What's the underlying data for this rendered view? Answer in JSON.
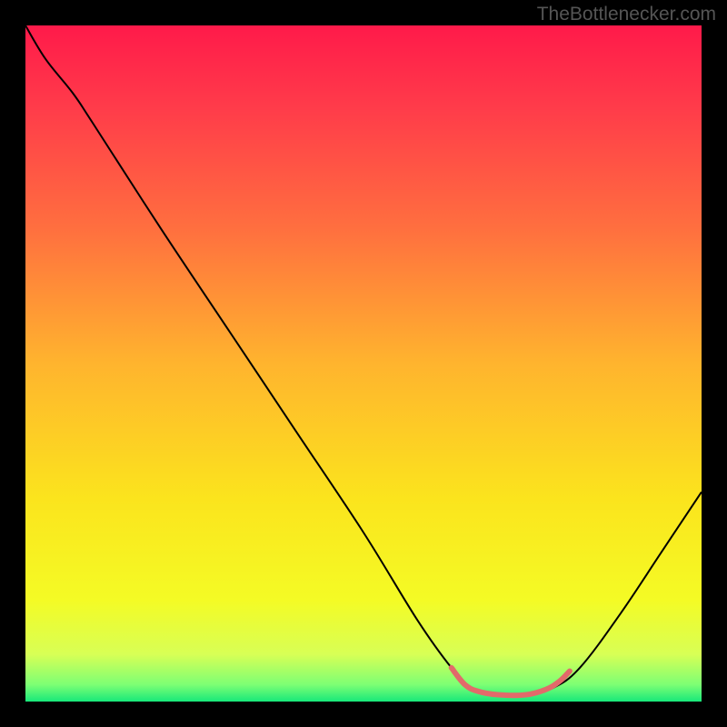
{
  "watermark": "TheBottlenecker.com",
  "chart_data": {
    "type": "line",
    "title": "",
    "xlabel": "",
    "ylabel": "",
    "xlim": [
      0,
      100
    ],
    "ylim": [
      0,
      100
    ],
    "background": {
      "kind": "vertical_gradient",
      "stops": [
        {
          "pos": 0.0,
          "color": "#ff1a4a"
        },
        {
          "pos": 0.12,
          "color": "#ff3b4a"
        },
        {
          "pos": 0.3,
          "color": "#ff6f3f"
        },
        {
          "pos": 0.5,
          "color": "#ffb42e"
        },
        {
          "pos": 0.7,
          "color": "#fbe41d"
        },
        {
          "pos": 0.85,
          "color": "#f4fb25"
        },
        {
          "pos": 0.93,
          "color": "#d8ff55"
        },
        {
          "pos": 0.975,
          "color": "#7dff74"
        },
        {
          "pos": 1.0,
          "color": "#18e87a"
        }
      ]
    },
    "series": [
      {
        "name": "bottleneck_curve",
        "stroke": "#000000",
        "width": 2,
        "points": [
          {
            "x": 0.0,
            "y": 100.0
          },
          {
            "x": 3.0,
            "y": 95.0
          },
          {
            "x": 7.0,
            "y": 90.0
          },
          {
            "x": 10.0,
            "y": 85.5
          },
          {
            "x": 20.0,
            "y": 70.0
          },
          {
            "x": 30.0,
            "y": 55.0
          },
          {
            "x": 40.0,
            "y": 40.0
          },
          {
            "x": 50.0,
            "y": 25.0
          },
          {
            "x": 58.0,
            "y": 12.0
          },
          {
            "x": 63.0,
            "y": 5.0
          },
          {
            "x": 66.0,
            "y": 2.0
          },
          {
            "x": 69.0,
            "y": 1.0
          },
          {
            "x": 74.0,
            "y": 1.0
          },
          {
            "x": 78.0,
            "y": 2.0
          },
          {
            "x": 82.0,
            "y": 5.0
          },
          {
            "x": 88.0,
            "y": 13.0
          },
          {
            "x": 94.0,
            "y": 22.0
          },
          {
            "x": 100.0,
            "y": 31.0
          }
        ]
      },
      {
        "name": "optimal_band",
        "stroke": "#e26a6a",
        "width": 6,
        "points": [
          {
            "x": 63.0,
            "y": 5.0
          },
          {
            "x": 65.0,
            "y": 2.5
          },
          {
            "x": 67.0,
            "y": 1.5
          },
          {
            "x": 70.0,
            "y": 1.0
          },
          {
            "x": 74.0,
            "y": 1.0
          },
          {
            "x": 77.0,
            "y": 1.8
          },
          {
            "x": 79.0,
            "y": 3.0
          },
          {
            "x": 80.5,
            "y": 4.5
          }
        ]
      }
    ]
  }
}
